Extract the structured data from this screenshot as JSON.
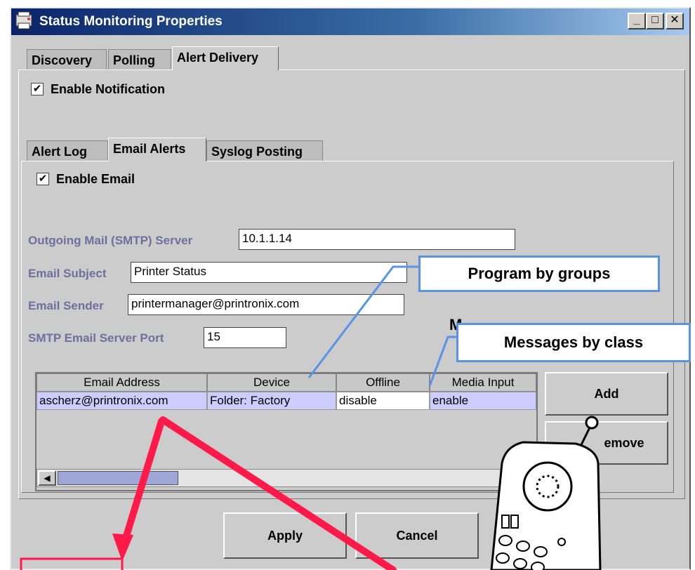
{
  "window": {
    "title": "Status Monitoring Properties"
  },
  "main_tabs": [
    {
      "label": "Discovery",
      "active": false
    },
    {
      "label": "Polling",
      "active": false
    },
    {
      "label": "Alert Delivery",
      "active": true
    }
  ],
  "enable_notification": {
    "label": "Enable Notification",
    "checked": true
  },
  "sub_tabs": [
    {
      "label": "Alert Log",
      "active": false
    },
    {
      "label": "Email Alerts",
      "active": true
    },
    {
      "label": "Syslog Posting",
      "active": false
    }
  ],
  "enable_email": {
    "label": "Enable Email",
    "checked": true
  },
  "fields": {
    "smtp_server": {
      "label": "Outgoing Mail (SMTP) Server",
      "value": "10.1.1.14"
    },
    "email_subject": {
      "label": "Email Subject",
      "value": "Printer Status"
    },
    "email_sender": {
      "label": "Email Sender",
      "value": "printermanager@printronix.com"
    },
    "smtp_port": {
      "label": "SMTP Email Server Port",
      "value": "15"
    }
  },
  "table": {
    "columns": [
      "Email Address",
      "Device",
      "Offline",
      "Media Input"
    ],
    "rows": [
      [
        "ascherz@printronix.com",
        "Folder: Factory",
        "disable",
        "enable"
      ]
    ]
  },
  "buttons": {
    "add": "Add",
    "remove": "emove",
    "apply": "Apply",
    "cancel": "Cancel"
  },
  "callouts": {
    "groups": "Program by groups",
    "classes": "Messages by class",
    "partial_letter": "M"
  },
  "check_mark": "✔",
  "scroll_left_glyph": "◀",
  "win_controls": [
    "_",
    "□",
    "✕"
  ],
  "colors": {
    "title_start": "#0a246a",
    "callout_border": "#5a93e6",
    "arrow_red": "#ff1a4a",
    "selected_row": "#ccccff"
  }
}
